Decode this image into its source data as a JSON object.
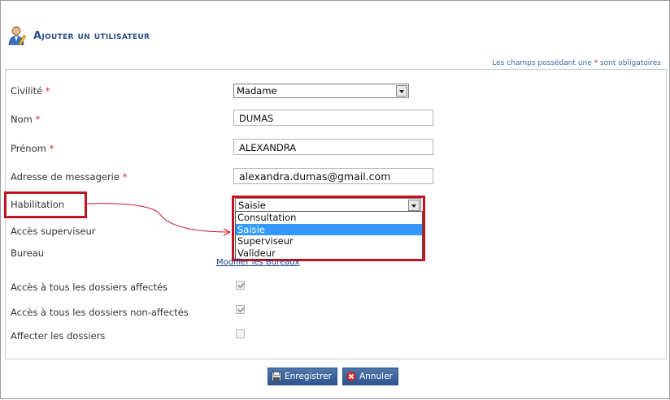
{
  "title": "Ajouter un utilisateur",
  "required_note": {
    "prefix": "Les champs possédant une ",
    "star": "*",
    "suffix": " sont obligatoires"
  },
  "fields": {
    "civilite": {
      "label": "Civilité",
      "star": "*",
      "value": "Madame"
    },
    "nom": {
      "label": "Nom",
      "star": "*",
      "value": "DUMAS"
    },
    "prenom": {
      "label": "Prénom",
      "star": "*",
      "value": "ALEXANDRA"
    },
    "email": {
      "label": "Adresse de messagerie",
      "star": "*",
      "value": "alexandra.dumas@gmail.com"
    },
    "habilitation": {
      "label": "Habilitation",
      "value": "Saisie",
      "options": [
        "Consultation",
        "Saisie",
        "Superviseur",
        "Valideur"
      ]
    },
    "acces_superviseur": {
      "label": "Accès superviseur"
    },
    "bureau": {
      "label": "Bureau",
      "link": "Modifier les Bureaux"
    },
    "acces_affectes": {
      "label": "Accès à tous les dossiers affectés",
      "checked": true
    },
    "acces_non_affectes": {
      "label": "Accès à tous les dossiers non-affectés",
      "checked": true
    },
    "affecter": {
      "label": "Affecter les dossiers",
      "checked": false
    }
  },
  "buttons": {
    "save": "Enregistrer",
    "cancel": "Annuler"
  },
  "colors": {
    "accent": "#2a4f8a",
    "highlight": "#c0141e",
    "selected": "#3399ff"
  }
}
